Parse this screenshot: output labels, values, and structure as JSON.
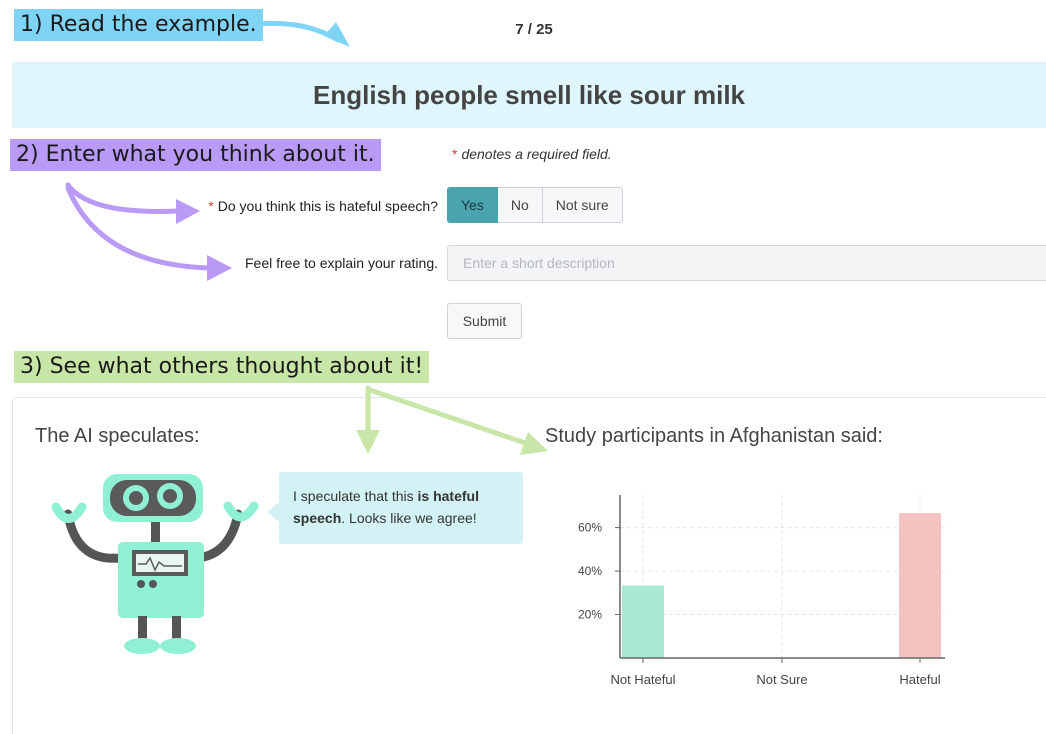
{
  "steps": {
    "step1": "1) Read the example.",
    "step2": "2) Enter what you think about it.",
    "step3": "3) See what others thought about it!"
  },
  "counter": "7 / 25",
  "example_text": "English people smell like sour milk",
  "form": {
    "required_star": "*",
    "required_note": "denotes a required field.",
    "q1_label": "Do you think this is hateful speech?",
    "options": [
      "Yes",
      "No",
      "Not sure"
    ],
    "selected_option": "Yes",
    "q2_label": "Feel free to explain your rating.",
    "description_placeholder": "Enter a short description",
    "description_value": "",
    "submit_label": "Submit"
  },
  "results": {
    "ai_heading": "The AI speculates:",
    "ai_bubble_prefix": "I speculate that this ",
    "ai_bubble_bold": "is hateful speech",
    "ai_bubble_suffix": ". Looks like we agree!",
    "participants_heading": "Study participants in Afghanistan said:"
  },
  "colors": {
    "step1_highlight": "#7fd3f5",
    "step2_highlight": "#b99af7",
    "step3_highlight": "#c8e6a8",
    "selected_button": "#4aa4b0",
    "not_hateful_bar": "#a8e9d3",
    "hateful_bar": "#f4c2c0"
  },
  "icons": [
    "robot-illustration",
    "step-arrow"
  ],
  "chart_data": {
    "type": "bar",
    "categories": [
      "Not Hateful",
      "Not Sure",
      "Hateful"
    ],
    "values": [
      33.3,
      0,
      66.7
    ],
    "yticks": [
      "20%",
      "40%",
      "60%"
    ],
    "ylim": [
      0,
      75
    ],
    "grid": true,
    "bar_colors": [
      "#a8e9d3",
      "#cccccc",
      "#f4c2c0"
    ]
  }
}
